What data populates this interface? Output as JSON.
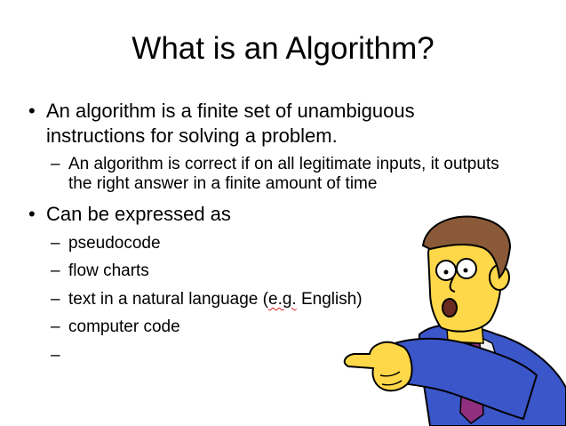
{
  "slide": {
    "title": "What is an Algorithm?",
    "bullets": [
      {
        "text_line1": "An algorithm is a finite set of unambiguous",
        "text_line2": "instructions for solving a problem.",
        "sub": [
          {
            "line1": "An algorithm is correct if on all legitimate inputs, it outputs",
            "line2": "the right answer in a finite amount of time"
          }
        ]
      },
      {
        "text": "Can be expressed as",
        "sub": [
          {
            "text": "pseudocode"
          },
          {
            "text": "flow charts"
          },
          {
            "text_before": "text in a natural language (",
            "text_marked": "e.g.",
            "text_after": " English)"
          },
          {
            "text": "computer code"
          },
          {
            "text": ""
          }
        ]
      }
    ],
    "bullet_glyph": "•",
    "dash_glyph": "–"
  },
  "figure": {
    "icon": "pointing-cartoon-man-icon"
  }
}
